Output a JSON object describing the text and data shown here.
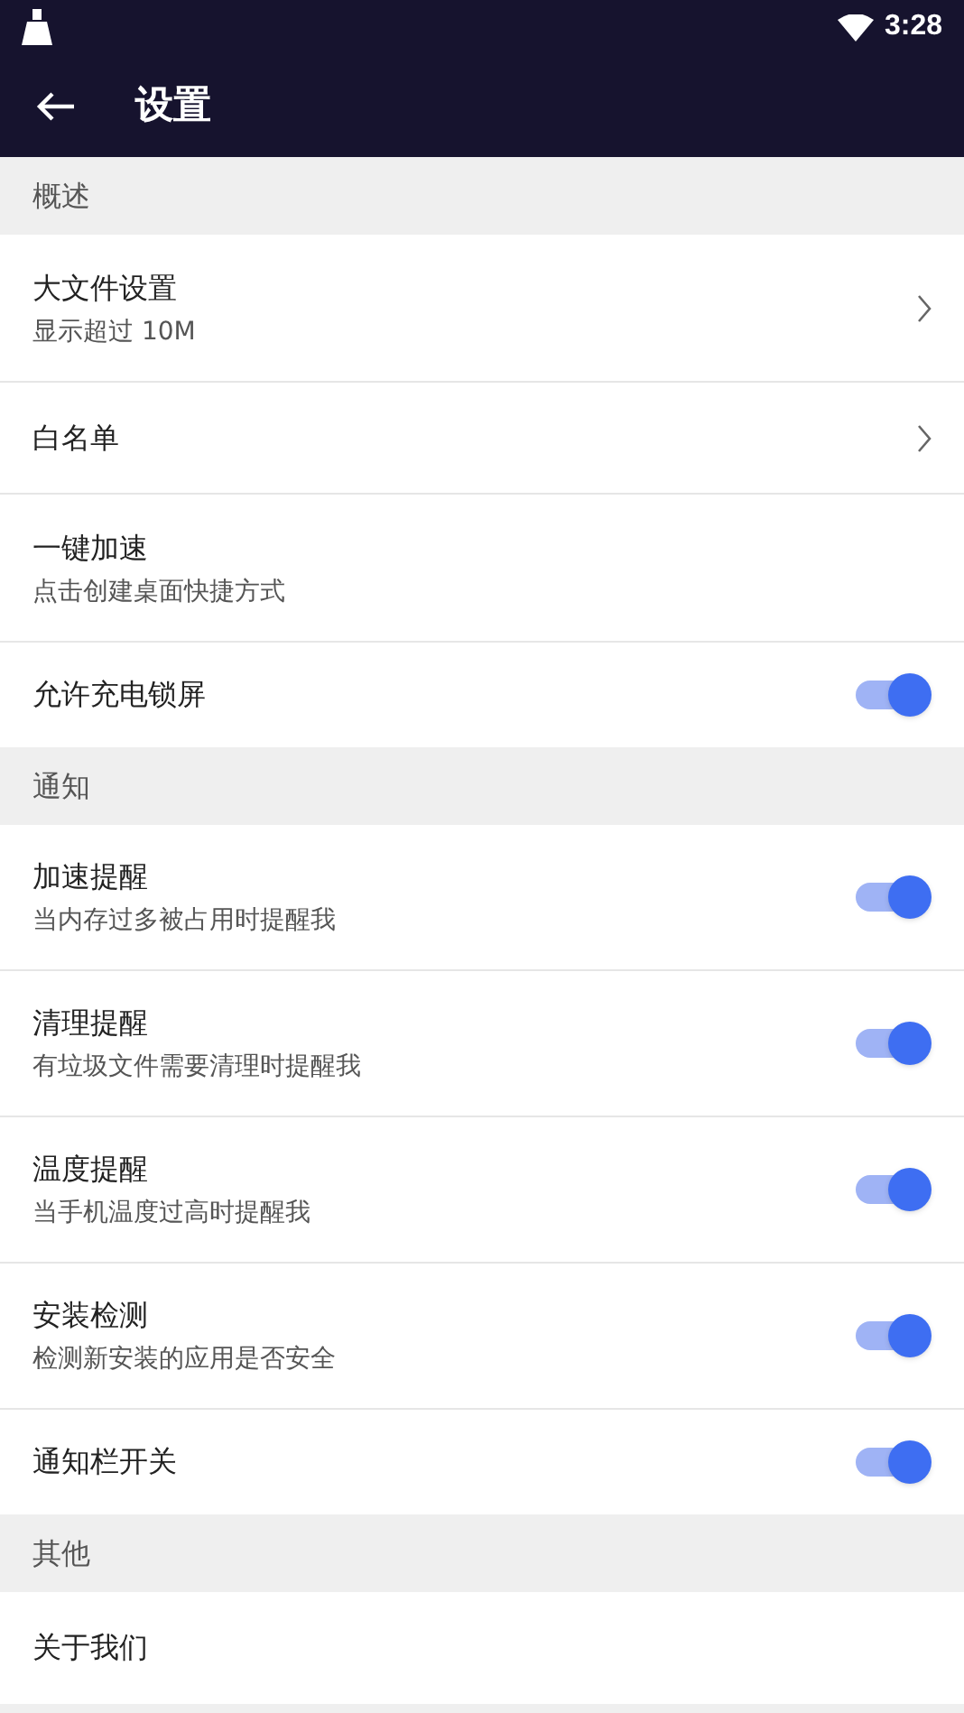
{
  "status_bar": {
    "time": "3:28"
  },
  "toolbar": {
    "title": "设置"
  },
  "sections": [
    {
      "header": "概述",
      "items": [
        {
          "kind": "chevron",
          "title": "大文件设置",
          "subtitle": "显示超过 10M"
        },
        {
          "kind": "chevron",
          "title": "白名单"
        },
        {
          "kind": "plain",
          "title": "一键加速",
          "subtitle": "点击创建桌面快捷方式"
        },
        {
          "kind": "switch",
          "title": "允许充电锁屏",
          "on": true
        }
      ]
    },
    {
      "header": "通知",
      "items": [
        {
          "kind": "switch",
          "title": "加速提醒",
          "subtitle": "当内存过多被占用时提醒我",
          "on": true
        },
        {
          "kind": "switch",
          "title": "清理提醒",
          "subtitle": "有垃圾文件需要清理时提醒我",
          "on": true
        },
        {
          "kind": "switch",
          "title": "温度提醒",
          "subtitle": "当手机温度过高时提醒我",
          "on": true
        },
        {
          "kind": "switch",
          "title": "安装检测",
          "subtitle": "检测新安装的应用是否安全",
          "on": true
        },
        {
          "kind": "switch",
          "title": "通知栏开关",
          "on": true
        }
      ]
    },
    {
      "header": "其他",
      "items": [
        {
          "kind": "plain",
          "title": "关于我们"
        }
      ]
    }
  ]
}
